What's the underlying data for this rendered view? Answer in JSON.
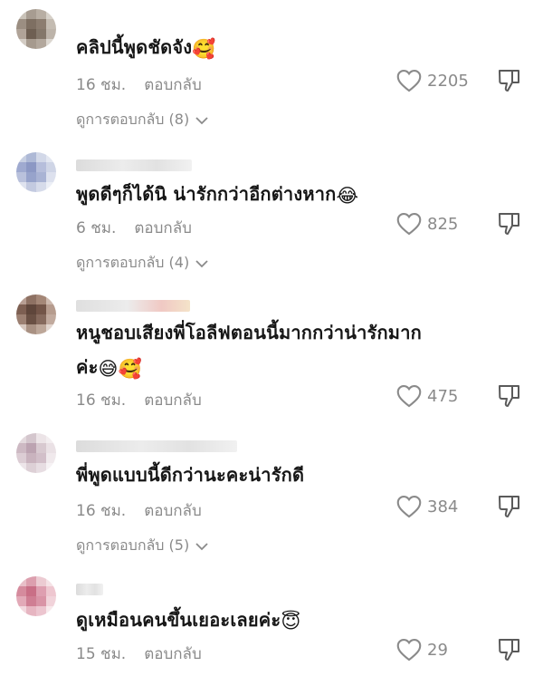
{
  "comments": [
    {
      "text": "คลิปนี้พูดชัดจัง",
      "emoji": "🥰",
      "time": "16 ชม.",
      "reply": "ตอบกลับ",
      "likes": "2205",
      "replies": "ดูการตอบกลับ (8)"
    },
    {
      "text": "พูดดีๆก็ได้นิ น่ารักกว่าอีกต่างหาก",
      "emoji": "😂",
      "time": "6 ชม.",
      "reply": "ตอบกลับ",
      "likes": "825",
      "replies": "ดูการตอบกลับ (4)"
    },
    {
      "text": "หนูชอบเสียงพี่โอลีฟตอนนี้มากกว่าน่ารักมาก",
      "text2": "ค่ะ",
      "emoji": "😅",
      "emoji2": "🥰",
      "time": "16 ชม.",
      "reply": "ตอบกลับ",
      "likes": "475",
      "replies": ""
    },
    {
      "text": "พี่พูดแบบนี้ดีกว่านะคะน่ารักดี",
      "emoji": "",
      "time": "16 ชม.",
      "reply": "ตอบกลับ",
      "likes": "384",
      "replies": "ดูการตอบกลับ (5)"
    },
    {
      "text": "ดูเหมือนคนขึ้นเยอะเลยค่ะ",
      "emoji": "😇",
      "time": "15 ชม.",
      "reply": "ตอบกลับ",
      "likes": "29",
      "replies": ""
    }
  ],
  "icons": {
    "like": "heart-outline-icon",
    "dislike": "thumbs-down-outline-icon",
    "expand": "chevron-down-icon"
  },
  "colors": {
    "text": "#161616",
    "meta": "#8a8a8a"
  }
}
